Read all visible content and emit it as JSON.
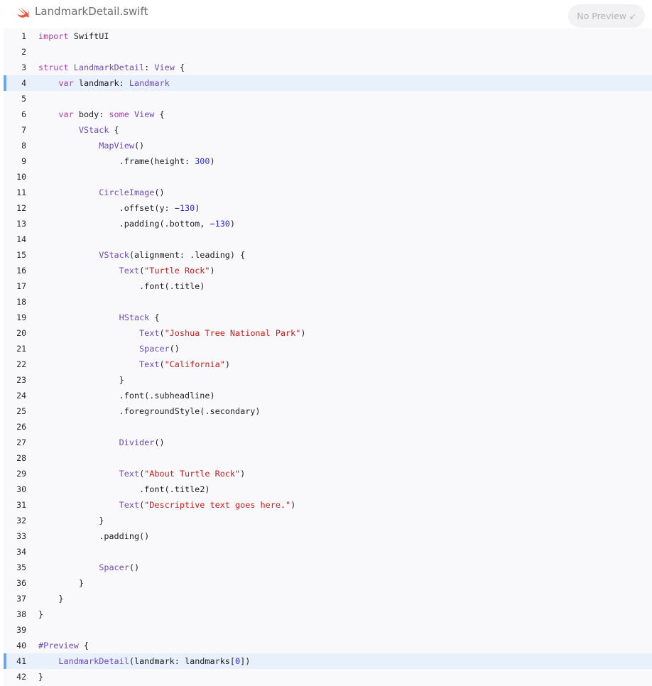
{
  "file": {
    "name": "LandmarkDetail.swift",
    "icon": "swift-icon",
    "accent": "#f05138"
  },
  "preview_button": {
    "label": "No Preview",
    "icon": "arrow-down-left-icon"
  },
  "highlighted_lines": [
    4,
    41
  ],
  "code": [
    {
      "n": "1",
      "tokens": [
        {
          "t": "import",
          "c": "kw"
        },
        {
          "t": " SwiftUI",
          "c": "plain"
        }
      ]
    },
    {
      "n": "2",
      "tokens": []
    },
    {
      "n": "3",
      "tokens": [
        {
          "t": "struct",
          "c": "kw"
        },
        {
          "t": " ",
          "c": "plain"
        },
        {
          "t": "LandmarkDetail",
          "c": "type"
        },
        {
          "t": ": ",
          "c": "plain"
        },
        {
          "t": "View",
          "c": "type"
        },
        {
          "t": " {",
          "c": "plain"
        }
      ]
    },
    {
      "n": "4",
      "tokens": [
        {
          "t": "    ",
          "c": "plain"
        },
        {
          "t": "var",
          "c": "kw"
        },
        {
          "t": " landmark: ",
          "c": "plain"
        },
        {
          "t": "Landmark",
          "c": "type"
        }
      ]
    },
    {
      "n": "5",
      "tokens": []
    },
    {
      "n": "6",
      "tokens": [
        {
          "t": "    ",
          "c": "plain"
        },
        {
          "t": "var",
          "c": "kw"
        },
        {
          "t": " body: ",
          "c": "plain"
        },
        {
          "t": "some",
          "c": "kw"
        },
        {
          "t": " ",
          "c": "plain"
        },
        {
          "t": "View",
          "c": "type"
        },
        {
          "t": " {",
          "c": "plain"
        }
      ]
    },
    {
      "n": "7",
      "tokens": [
        {
          "t": "        ",
          "c": "plain"
        },
        {
          "t": "VStack",
          "c": "type"
        },
        {
          "t": " {",
          "c": "plain"
        }
      ]
    },
    {
      "n": "8",
      "tokens": [
        {
          "t": "            ",
          "c": "plain"
        },
        {
          "t": "MapView",
          "c": "type"
        },
        {
          "t": "()",
          "c": "plain"
        }
      ]
    },
    {
      "n": "9",
      "tokens": [
        {
          "t": "                .frame(height: ",
          "c": "plain"
        },
        {
          "t": "300",
          "c": "num"
        },
        {
          "t": ")",
          "c": "plain"
        }
      ]
    },
    {
      "n": "10",
      "tokens": []
    },
    {
      "n": "11",
      "tokens": [
        {
          "t": "            ",
          "c": "plain"
        },
        {
          "t": "CircleImage",
          "c": "type"
        },
        {
          "t": "()",
          "c": "plain"
        }
      ]
    },
    {
      "n": "12",
      "tokens": [
        {
          "t": "                .offset(y: −",
          "c": "plain"
        },
        {
          "t": "130",
          "c": "num"
        },
        {
          "t": ")",
          "c": "plain"
        }
      ]
    },
    {
      "n": "13",
      "tokens": [
        {
          "t": "                .padding(.bottom, −",
          "c": "plain"
        },
        {
          "t": "130",
          "c": "num"
        },
        {
          "t": ")",
          "c": "plain"
        }
      ]
    },
    {
      "n": "14",
      "tokens": []
    },
    {
      "n": "15",
      "tokens": [
        {
          "t": "            ",
          "c": "plain"
        },
        {
          "t": "VStack",
          "c": "type"
        },
        {
          "t": "(alignment: .leading) {",
          "c": "plain"
        }
      ]
    },
    {
      "n": "16",
      "tokens": [
        {
          "t": "                ",
          "c": "plain"
        },
        {
          "t": "Text",
          "c": "type"
        },
        {
          "t": "(",
          "c": "plain"
        },
        {
          "t": "\"Turtle Rock\"",
          "c": "str"
        },
        {
          "t": ")",
          "c": "plain"
        }
      ]
    },
    {
      "n": "17",
      "tokens": [
        {
          "t": "                    .font(.title)",
          "c": "plain"
        }
      ]
    },
    {
      "n": "18",
      "tokens": []
    },
    {
      "n": "19",
      "tokens": [
        {
          "t": "                ",
          "c": "plain"
        },
        {
          "t": "HStack",
          "c": "type"
        },
        {
          "t": " {",
          "c": "plain"
        }
      ]
    },
    {
      "n": "20",
      "tokens": [
        {
          "t": "                    ",
          "c": "plain"
        },
        {
          "t": "Text",
          "c": "type"
        },
        {
          "t": "(",
          "c": "plain"
        },
        {
          "t": "\"Joshua Tree National Park\"",
          "c": "str"
        },
        {
          "t": ")",
          "c": "plain"
        }
      ]
    },
    {
      "n": "21",
      "tokens": [
        {
          "t": "                    ",
          "c": "plain"
        },
        {
          "t": "Spacer",
          "c": "type"
        },
        {
          "t": "()",
          "c": "plain"
        }
      ]
    },
    {
      "n": "22",
      "tokens": [
        {
          "t": "                    ",
          "c": "plain"
        },
        {
          "t": "Text",
          "c": "type"
        },
        {
          "t": "(",
          "c": "plain"
        },
        {
          "t": "\"California\"",
          "c": "str"
        },
        {
          "t": ")",
          "c": "plain"
        }
      ]
    },
    {
      "n": "23",
      "tokens": [
        {
          "t": "                }",
          "c": "plain"
        }
      ]
    },
    {
      "n": "24",
      "tokens": [
        {
          "t": "                .font(.subheadline)",
          "c": "plain"
        }
      ]
    },
    {
      "n": "25",
      "tokens": [
        {
          "t": "                .foregroundStyle(.secondary)",
          "c": "plain"
        }
      ]
    },
    {
      "n": "26",
      "tokens": []
    },
    {
      "n": "27",
      "tokens": [
        {
          "t": "                ",
          "c": "plain"
        },
        {
          "t": "Divider",
          "c": "type"
        },
        {
          "t": "()",
          "c": "plain"
        }
      ]
    },
    {
      "n": "28",
      "tokens": []
    },
    {
      "n": "29",
      "tokens": [
        {
          "t": "                ",
          "c": "plain"
        },
        {
          "t": "Text",
          "c": "type"
        },
        {
          "t": "(",
          "c": "plain"
        },
        {
          "t": "\"About Turtle Rock\"",
          "c": "str"
        },
        {
          "t": ")",
          "c": "plain"
        }
      ]
    },
    {
      "n": "30",
      "tokens": [
        {
          "t": "                    .font(.title2)",
          "c": "plain"
        }
      ]
    },
    {
      "n": "31",
      "tokens": [
        {
          "t": "                ",
          "c": "plain"
        },
        {
          "t": "Text",
          "c": "type"
        },
        {
          "t": "(",
          "c": "plain"
        },
        {
          "t": "\"Descriptive text goes here.\"",
          "c": "str"
        },
        {
          "t": ")",
          "c": "plain"
        }
      ]
    },
    {
      "n": "32",
      "tokens": [
        {
          "t": "            }",
          "c": "plain"
        }
      ]
    },
    {
      "n": "33",
      "tokens": [
        {
          "t": "            .padding()",
          "c": "plain"
        }
      ]
    },
    {
      "n": "34",
      "tokens": []
    },
    {
      "n": "35",
      "tokens": [
        {
          "t": "            ",
          "c": "plain"
        },
        {
          "t": "Spacer",
          "c": "type"
        },
        {
          "t": "()",
          "c": "plain"
        }
      ]
    },
    {
      "n": "36",
      "tokens": [
        {
          "t": "        }",
          "c": "plain"
        }
      ]
    },
    {
      "n": "37",
      "tokens": [
        {
          "t": "    }",
          "c": "plain"
        }
      ]
    },
    {
      "n": "38",
      "tokens": [
        {
          "t": "}",
          "c": "plain"
        }
      ]
    },
    {
      "n": "39",
      "tokens": []
    },
    {
      "n": "40",
      "tokens": [
        {
          "t": "#Preview",
          "c": "type"
        },
        {
          "t": " {",
          "c": "plain"
        }
      ]
    },
    {
      "n": "41",
      "tokens": [
        {
          "t": "    ",
          "c": "plain"
        },
        {
          "t": "LandmarkDetail",
          "c": "type"
        },
        {
          "t": "(landmark: landmarks[",
          "c": "plain"
        },
        {
          "t": "0",
          "c": "num"
        },
        {
          "t": "])",
          "c": "plain"
        }
      ]
    },
    {
      "n": "42",
      "tokens": [
        {
          "t": "}",
          "c": "plain"
        }
      ]
    }
  ]
}
